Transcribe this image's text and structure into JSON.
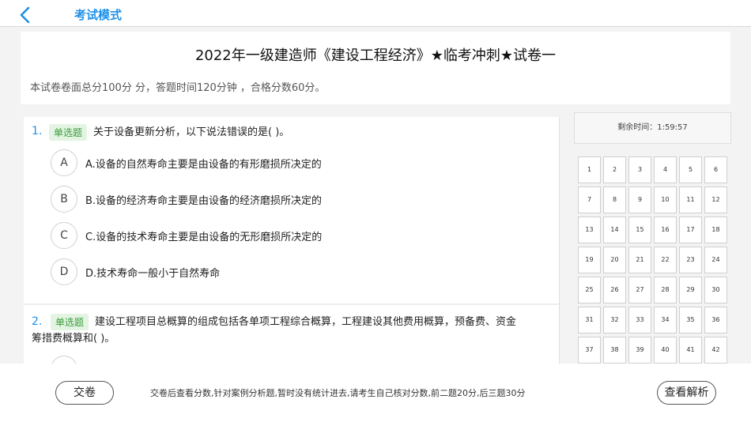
{
  "topbar": {
    "title": "考试模式",
    "accent": "#1e90e8"
  },
  "paper": {
    "title": "2022年一级建造师《建设工程经济》★临考冲刺★试卷一",
    "description": "本试卷卷面总分100分 分，答题时间120分钟 ，合格分数60分。"
  },
  "questions": [
    {
      "number": "1.",
      "tag": "单选题",
      "text": "关于设备更新分析，以下说法错误的是(   )。",
      "options": [
        {
          "letter": "A",
          "text": "A.设备的自然寿命主要是由设备的有形磨损所决定的"
        },
        {
          "letter": "B",
          "text": "B.设备的经济寿命主要是由设备的经济磨损所决定的"
        },
        {
          "letter": "C",
          "text": "C.设备的技术寿命主要是由设备的无形磨损所决定的"
        },
        {
          "letter": "D",
          "text": "D.技术寿命一般小于自然寿命"
        }
      ]
    },
    {
      "number": "2.",
      "tag": "单选题",
      "text_line1": "建设工程项目总概算的组成包括各单项工程综合概算，工程建设其他费用概算，预备费、资金",
      "text_line2": "筹措费概算和(   )。"
    }
  ],
  "timer": {
    "text": "剩余时间：1:59:57"
  },
  "answer_sheet": {
    "numbers": [
      "1",
      "2",
      "3",
      "4",
      "5",
      "6",
      "7",
      "8",
      "9",
      "10",
      "11",
      "12",
      "13",
      "14",
      "15",
      "16",
      "17",
      "18",
      "19",
      "20",
      "21",
      "22",
      "23",
      "24",
      "25",
      "26",
      "27",
      "28",
      "29",
      "30",
      "31",
      "32",
      "33",
      "34",
      "35",
      "36",
      "37",
      "38",
      "39",
      "40",
      "41",
      "42"
    ]
  },
  "bottom": {
    "submit_label": "交卷",
    "notice": "交卷后查看分数,针对案例分析题,暂时没有统计进去,请考生自己核对分数,前二题20分,后三题30分",
    "review_label": "查看解析"
  }
}
